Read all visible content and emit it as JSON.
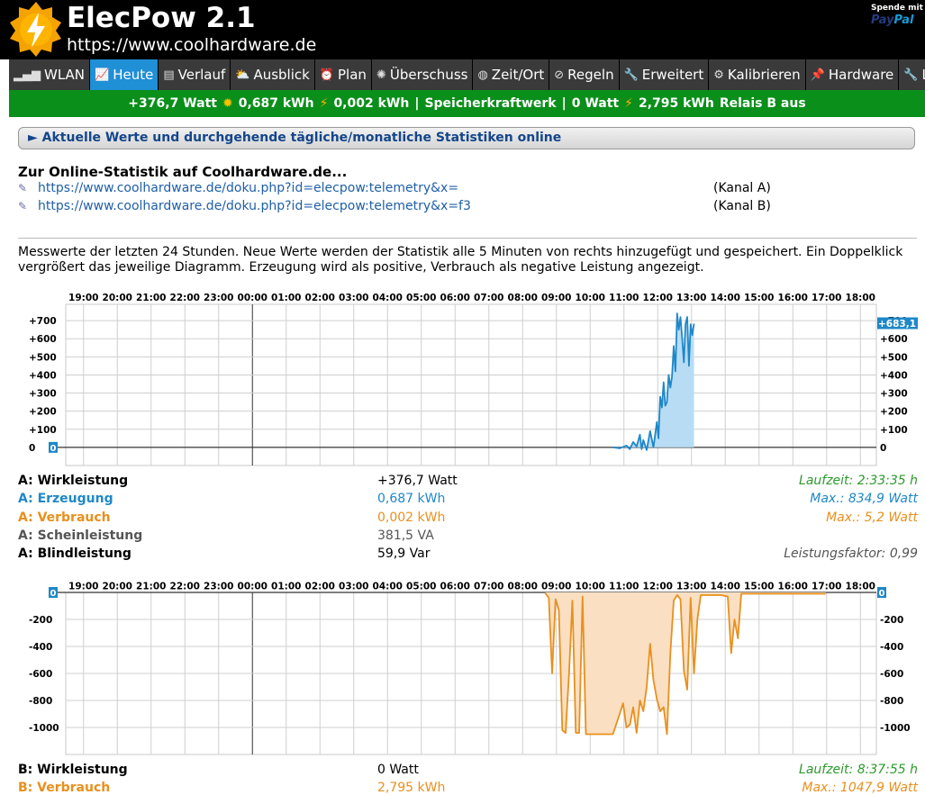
{
  "app": {
    "title": "ElecPow 2.1",
    "url": "https://www.coolhardware.de",
    "donate_label": "Spende mit",
    "paypal": "PayPal"
  },
  "nav": {
    "tabs": [
      {
        "label": "WLAN",
        "icon": "signal-bars-icon",
        "glyph": "▂▄▆",
        "active": false
      },
      {
        "label": "Heute",
        "icon": "line-chart-icon",
        "glyph": "📈",
        "active": true
      },
      {
        "label": "Verlauf",
        "icon": "calendar-icon",
        "glyph": "▤",
        "active": false
      },
      {
        "label": "Ausblick",
        "icon": "cloud-sun-icon",
        "glyph": "⛅",
        "active": false
      },
      {
        "label": "Plan",
        "icon": "alarm-clock-icon",
        "glyph": "⏰",
        "active": false
      },
      {
        "label": "Überschuss",
        "icon": "gear-icon",
        "glyph": "✺",
        "active": false
      },
      {
        "label": "Zeit/Ort",
        "icon": "globe-icon",
        "glyph": "◍",
        "active": false
      },
      {
        "label": "Regeln",
        "icon": "no-entry-icon",
        "glyph": "⊘",
        "active": false
      },
      {
        "label": "Erweitert",
        "icon": "wrench-icon",
        "glyph": "🔧",
        "active": false
      },
      {
        "label": "Kalibrieren",
        "icon": "cog-icon",
        "glyph": "⚙",
        "active": false
      },
      {
        "label": "Hardware",
        "icon": "pin-icon",
        "glyph": "📌",
        "active": false
      },
      {
        "label": "Log",
        "icon": "list-icon",
        "glyph": "🔧",
        "active": false
      }
    ]
  },
  "status": {
    "power": "+376,7 Watt",
    "energy_in": "0,687 kWh",
    "energy_out": "0,002 kWh",
    "separator": "|",
    "storage_label": "Speicherkraftwerk",
    "storage_power": "0 Watt",
    "storage_energy": "2,795 kWh",
    "relay": "Relais B aus"
  },
  "accordion": {
    "label": "► Aktuelle Werte und durchgehende tägliche/monatliche Statistiken online"
  },
  "online": {
    "heading": "Zur Online-Statistik auf Coolhardware.de...",
    "links": [
      {
        "url": "https://www.coolhardware.de/doku.php?id=elecpow:telemetry&x=",
        "channel": "(Kanal A)"
      },
      {
        "url": "https://www.coolhardware.de/doku.php?id=elecpow:telemetry&x=f3",
        "channel": "(Kanal B)"
      }
    ]
  },
  "description": "Messwerte der letzten 24 Stunden. Neue Werte werden der Statistik alle 5 Minuten von rechts hinzugefügt und gespeichert. Ein Doppelklick vergrößert das jeweilige Diagramm. Erzeugung wird als positive, Verbrauch als negative Leistung angezeigt.",
  "colors": {
    "header_bg": "#000000",
    "tab_bg": "#3a3a3a",
    "tab_active": "#1f8fd6",
    "status_green": "#0a8f1a",
    "production_blue": "#1e88c8",
    "consumption_orange": "#e8901d",
    "runtime_green": "#2c9a2c"
  },
  "chart_data": [
    {
      "type": "area",
      "hours": [
        "19:00",
        "20:00",
        "21:00",
        "22:00",
        "23:00",
        "00:00",
        "01:00",
        "02:00",
        "03:00",
        "04:00",
        "05:00",
        "06:00",
        "07:00",
        "08:00",
        "09:00",
        "10:00",
        "11:00",
        "12:00",
        "13:00",
        "14:00",
        "15:00",
        "16:00",
        "17:00",
        "18:00"
      ],
      "yticks": [
        "+700",
        "+600",
        "+500",
        "+400",
        "+300",
        "+200",
        "+100",
        "0"
      ],
      "ytick_values": [
        700,
        600,
        500,
        400,
        300,
        200,
        100,
        0
      ],
      "ylim": [
        -100,
        790
      ],
      "current_label": "+683,1",
      "zero_label": "0",
      "midnight_hour": "00:00",
      "series": [
        {
          "color": "#1e88c8",
          "points": [
            [
              16.2,
              0
            ],
            [
              16.4,
              -5
            ],
            [
              16.6,
              10
            ],
            [
              16.7,
              -10
            ],
            [
              16.8,
              30
            ],
            [
              16.9,
              5
            ],
            [
              17.0,
              70
            ],
            [
              17.05,
              -10
            ],
            [
              17.1,
              40
            ],
            [
              17.2,
              -15
            ],
            [
              17.3,
              90
            ],
            [
              17.4,
              0
            ],
            [
              17.5,
              140
            ],
            [
              17.55,
              50
            ],
            [
              17.6,
              280
            ],
            [
              17.65,
              220
            ],
            [
              17.7,
              360
            ],
            [
              17.75,
              230
            ],
            [
              17.8,
              250
            ],
            [
              17.85,
              400
            ],
            [
              17.9,
              330
            ],
            [
              17.95,
              390
            ],
            [
              18.0,
              560
            ],
            [
              18.05,
              420
            ],
            [
              18.1,
              740
            ],
            [
              18.15,
              650
            ],
            [
              18.2,
              720
            ],
            [
              18.25,
              600
            ],
            [
              18.3,
              470
            ],
            [
              18.35,
              680
            ],
            [
              18.4,
              720
            ],
            [
              18.45,
              450
            ],
            [
              18.5,
              680
            ],
            [
              18.55,
              620
            ],
            [
              18.6,
              683.1
            ]
          ]
        }
      ]
    },
    {
      "type": "area",
      "hours": [
        "19:00",
        "20:00",
        "21:00",
        "22:00",
        "23:00",
        "00:00",
        "01:00",
        "02:00",
        "03:00",
        "04:00",
        "05:00",
        "06:00",
        "07:00",
        "08:00",
        "09:00",
        "10:00",
        "11:00",
        "12:00",
        "13:00",
        "14:00",
        "15:00",
        "16:00",
        "17:00",
        "18:00"
      ],
      "yticks": [
        "-200",
        "-400",
        "-600",
        "-800",
        "-1000"
      ],
      "ytick_values": [
        -200,
        -400,
        -600,
        -800,
        -1000
      ],
      "ylim": [
        -1200,
        0
      ],
      "zero_label": "0",
      "midnight_hour": "00:00",
      "series": [
        {
          "color": "#e8901d",
          "points": [
            [
              14.2,
              -5
            ],
            [
              14.3,
              -40
            ],
            [
              14.4,
              -600
            ],
            [
              14.5,
              -50
            ],
            [
              14.6,
              -130
            ],
            [
              14.7,
              -1020
            ],
            [
              14.8,
              -1040
            ],
            [
              14.9,
              -600
            ],
            [
              15.0,
              -60
            ],
            [
              15.1,
              -1040
            ],
            [
              15.2,
              -1040
            ],
            [
              15.3,
              -30
            ],
            [
              15.4,
              -1050
            ],
            [
              15.6,
              -1050
            ],
            [
              15.8,
              -1050
            ],
            [
              16.0,
              -1050
            ],
            [
              16.2,
              -1050
            ],
            [
              16.4,
              -900
            ],
            [
              16.5,
              -820
            ],
            [
              16.6,
              -1000
            ],
            [
              16.7,
              -980
            ],
            [
              16.8,
              -850
            ],
            [
              16.9,
              -1040
            ],
            [
              17.0,
              -800
            ],
            [
              17.1,
              -880
            ],
            [
              17.2,
              -700
            ],
            [
              17.3,
              -380
            ],
            [
              17.4,
              -650
            ],
            [
              17.5,
              -790
            ],
            [
              17.6,
              -880
            ],
            [
              17.7,
              -850
            ],
            [
              17.8,
              -1050
            ],
            [
              17.9,
              -450
            ],
            [
              18.0,
              -60
            ],
            [
              18.1,
              -20
            ],
            [
              18.2,
              -50
            ],
            [
              18.3,
              -580
            ],
            [
              18.4,
              -720
            ],
            [
              18.5,
              -40
            ],
            [
              18.6,
              -600
            ],
            [
              18.7,
              -200
            ],
            [
              18.8,
              -20
            ],
            [
              19.4,
              -20
            ],
            [
              19.6,
              -30
            ],
            [
              19.7,
              -450
            ],
            [
              19.8,
              -200
            ],
            [
              19.9,
              -340
            ],
            [
              20.0,
              -10
            ],
            [
              20.5,
              -10
            ],
            [
              22.0,
              -10
            ],
            [
              22.5,
              -10
            ]
          ]
        }
      ]
    }
  ],
  "channel_a": {
    "rows": [
      {
        "label": "A: Wirkleistung",
        "value": "+376,7 Watt",
        "right": "Laufzeit: 2:33:35 h"
      },
      {
        "label": "A: Erzeugung",
        "value": "0,687 kWh",
        "right": "Max.: 834,9 Watt"
      },
      {
        "label": "A: Verbrauch",
        "value": "0,002 kWh",
        "right": "Max.: 5,2 Watt"
      },
      {
        "label": "A: Scheinleistung",
        "value": "381,5 VA",
        "right": ""
      },
      {
        "label": "A: Blindleistung",
        "value": "59,9 Var",
        "right": "Leistungsfaktor: 0,99"
      }
    ]
  },
  "channel_b": {
    "rows": [
      {
        "label": "B: Wirkleistung",
        "value": "0 Watt",
        "right": "Laufzeit: 8:37:55 h"
      },
      {
        "label": "B: Verbrauch",
        "value": "2,795 kWh",
        "right": "Max.: 1047,9 Watt"
      }
    ]
  }
}
